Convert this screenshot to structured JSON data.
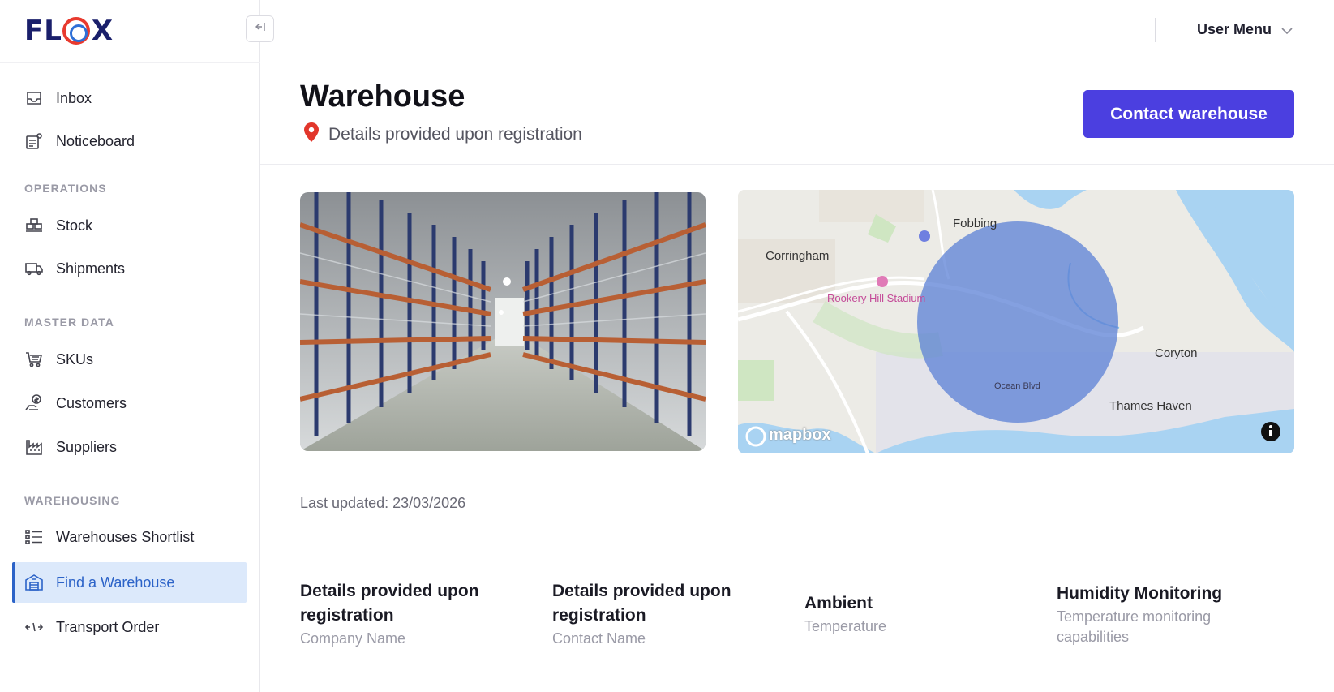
{
  "brand": {
    "letters": [
      "F",
      "L",
      "X"
    ]
  },
  "sidebar": {
    "collapse_icon": "collapse-left-icon",
    "items_top": [
      {
        "label": "Inbox",
        "icon": "inbox-icon"
      },
      {
        "label": "Noticeboard",
        "icon": "noticeboard-icon"
      }
    ],
    "sections": [
      {
        "title": "OPERATIONS",
        "items": [
          {
            "label": "Stock",
            "icon": "stock-icon"
          },
          {
            "label": "Shipments",
            "icon": "truck-icon"
          }
        ]
      },
      {
        "title": "MASTER DATA",
        "items": [
          {
            "label": "SKUs",
            "icon": "cart-icon"
          },
          {
            "label": "Customers",
            "icon": "customer-icon"
          },
          {
            "label": "Suppliers",
            "icon": "factory-icon"
          }
        ]
      },
      {
        "title": "WAREHOUSING",
        "items": [
          {
            "label": "Warehouses Shortlist",
            "icon": "list-icon"
          },
          {
            "label": "Find a Warehouse",
            "icon": "warehouse-icon",
            "active": true
          },
          {
            "label": "Transport Order",
            "icon": "transport-arrows-icon"
          }
        ]
      }
    ]
  },
  "header": {
    "user_menu": "User Menu"
  },
  "page": {
    "title": "Warehouse",
    "location": "Details provided upon registration",
    "contact_button": "Contact warehouse",
    "last_updated": "Last updated: 23/03/2026"
  },
  "map": {
    "labels": {
      "fobbing": "Fobbing",
      "corringham": "Corringham",
      "stadium": "Rookery Hill Stadium",
      "coryton": "Coryton",
      "thames_haven": "Thames Haven",
      "ocean_blvd": "Ocean Blvd"
    },
    "attribution": "mapbox",
    "colors": {
      "water": "#a9d3f2",
      "park": "#cfe6c2",
      "circle": "#5b80d6"
    }
  },
  "details": [
    {
      "value": "Details provided upon registration",
      "label": "Company Name"
    },
    {
      "value": "Details provided upon registration",
      "label": "Contact Name"
    },
    {
      "value": "Ambient",
      "label": "Temperature"
    },
    {
      "value": "Humidity Monitoring",
      "label": "Temperature monitoring capabilities"
    }
  ],
  "colors": {
    "primary_button": "#4b3fe0",
    "active_nav_bg": "#dce9fb",
    "active_nav_text": "#2c63c8",
    "pin": "#e2362b"
  }
}
